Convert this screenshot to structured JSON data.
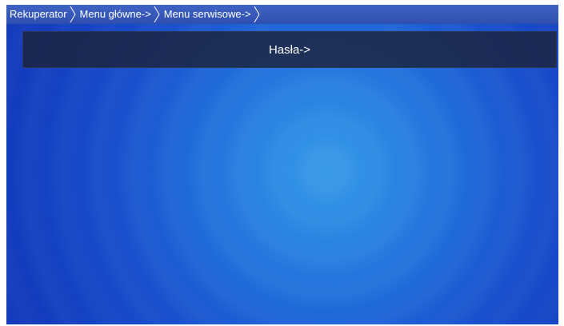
{
  "breadcrumb": {
    "items": [
      "Rekuperator",
      "Menu główne->",
      "Menu serwisowe->"
    ]
  },
  "menu": {
    "items": [
      "Hasła->"
    ]
  },
  "colors": {
    "breadcrumb_bar": "#3552b8",
    "background": "#1f68d8",
    "menu_item_bg": "#1c223c",
    "text": "#ffffff"
  }
}
